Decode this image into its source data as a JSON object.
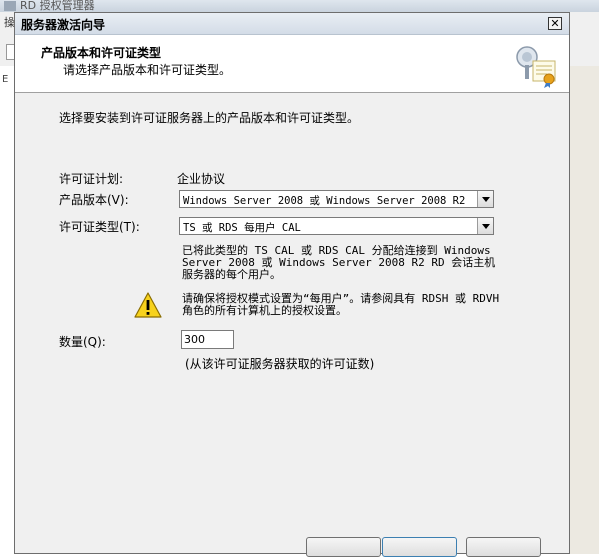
{
  "background_window": {
    "title": "RD 授权管理器",
    "menu_first": "操",
    "tree_node": "E"
  },
  "dialog": {
    "title": "服务器激活向导",
    "close_symbol": "✕",
    "header": {
      "title": "产品版本和许可证类型",
      "subtitle": "请选择产品版本和许可证类型。"
    },
    "intro": "选择要安装到许可证服务器上的产品版本和许可证类型。",
    "license_plan": {
      "label": "许可证计划:",
      "value": "企业协议"
    },
    "product_version": {
      "label": "产品版本(V):",
      "value": "Windows Server 2008 或 Windows Server 2008 R2"
    },
    "license_type": {
      "label": "许可证类型(T):",
      "value": "TS 或 RDS 每用户 CAL"
    },
    "info_text": "已将此类型的 TS CAL 或 RDS CAL 分配给连接到 Windows Server 2008 或 Windows Server 2008 R2 RD 会话主机服务器的每个用户。",
    "warning_text": "请确保将授权模式设置为“每用户”。请参阅具有 RDSH 或 RDVH 角色的所有计算机上的授权设置。",
    "quantity": {
      "label": "数量(Q):",
      "value": "300",
      "hint": "(从该许可证服务器获取的许可证数)"
    }
  },
  "colors": {
    "dialog_bg": "#f0f0f0",
    "header_bg": "#ffffff",
    "warning_yellow": "#f7d21d"
  }
}
